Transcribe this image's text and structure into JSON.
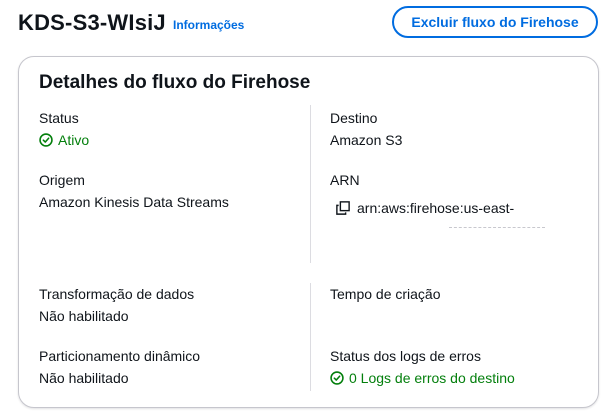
{
  "header": {
    "title": "KDS-S3-WIsiJ",
    "info_link": "Informações",
    "delete_button": "Excluir fluxo do Firehose"
  },
  "panel": {
    "title": "Detalhes do fluxo do Firehose",
    "status": {
      "label": "Status",
      "value": "Ativo"
    },
    "destination": {
      "label": "Destino",
      "value": "Amazon S3"
    },
    "source": {
      "label": "Origem",
      "value": "Amazon Kinesis Data Streams"
    },
    "arn": {
      "label": "ARN",
      "value": "arn:aws:firehose:us-east-"
    },
    "transformation": {
      "label": "Transformação de dados",
      "value": "Não habilitado"
    },
    "creation_time": {
      "label": "Tempo de criação"
    },
    "dynamic_partitioning": {
      "label": "Particionamento dinâmico",
      "value": "Não habilitado"
    },
    "error_logs": {
      "label": "Status dos logs de erros",
      "value": "0 Logs de erros do destino"
    }
  },
  "colors": {
    "link": "#006ce0",
    "success": "#037f0c",
    "text": "#0f141a",
    "border": "#c6c6cd"
  },
  "icons": [
    "status-positive-icon",
    "copy-icon"
  ]
}
